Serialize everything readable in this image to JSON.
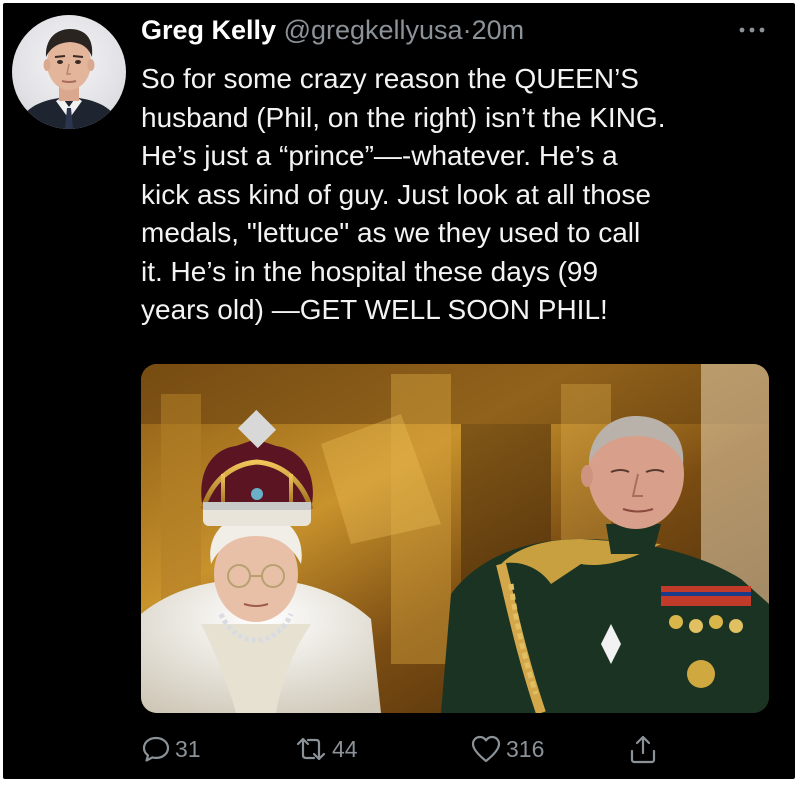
{
  "tweet": {
    "author_name": "Greg Kelly",
    "handle": "@gregkellyusa",
    "separator": "·",
    "time": "20m",
    "text": "So for some crazy reason the QUEEN’S\nhusband (Phil, on the right) isn’t the KING.\nHe’s just a “prince”—-whatever. He’s a\nkick ass kind of guy. Just look at all those\nmedals, \"lettuce\" as we they used to call\nit.  He’s in the hospital these days (99\nyears old) —GET WELL SOON PHIL!",
    "avatar_icon": "profile-photo",
    "more_icon": "more-dots-icon",
    "media": {
      "description_icon": "photo-queen-and-prince"
    }
  },
  "actions": {
    "reply_count": "31",
    "retweet_count": "44",
    "like_count": "316",
    "reply_icon": "reply-icon",
    "retweet_icon": "retweet-icon",
    "like_icon": "heart-icon",
    "share_icon": "share-icon"
  },
  "colors": {
    "background": "#000000",
    "text": "#f3f3f3",
    "muted": "#8b9298"
  }
}
